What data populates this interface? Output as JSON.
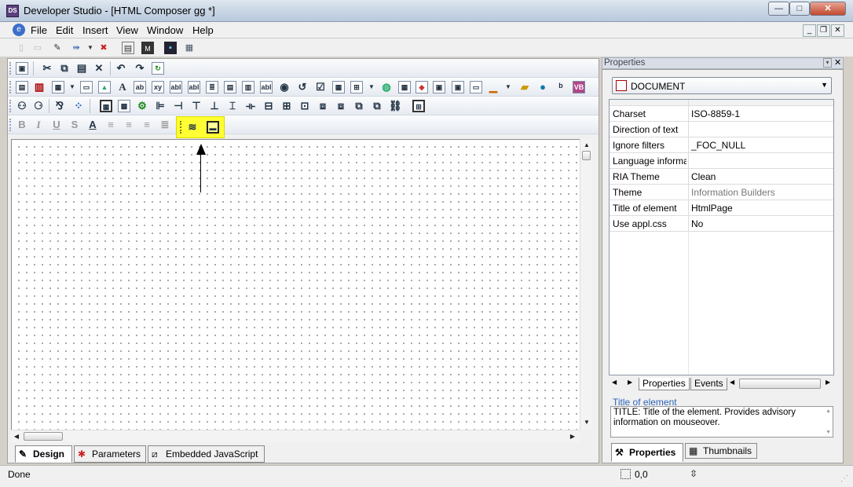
{
  "window": {
    "title": "Developer Studio - [HTML Composer gg *]",
    "app_icon_text": "DS",
    "controls": {
      "minimize": "—",
      "maximize": "□",
      "close": "✕"
    }
  },
  "menu": {
    "items": [
      "File",
      "Edit",
      "Insert",
      "View",
      "Window",
      "Help"
    ],
    "mdi_controls": {
      "minimize": "_",
      "restore": "❐",
      "close": "✕"
    }
  },
  "canvas": {
    "annotation_arrow_direction": "up",
    "highlight_color": "#ffff33"
  },
  "bottom_tabs": [
    {
      "label": "Design",
      "icon": "pencil-page-icon",
      "active": true
    },
    {
      "label": "Parameters",
      "icon": "parameters-icon",
      "active": false
    },
    {
      "label": "Embedded JavaScript",
      "icon": "script-icon",
      "active": false
    }
  ],
  "properties": {
    "title": "Properties",
    "selected_object": "DOCUMENT",
    "rows": [
      {
        "name": "Charset",
        "value": "ISO-8859-1",
        "muted": false
      },
      {
        "name": "Direction of text",
        "value": "",
        "muted": false
      },
      {
        "name": "Ignore filters",
        "value": "_FOC_NULL",
        "muted": false
      },
      {
        "name": "Language informatio",
        "value": "",
        "muted": false
      },
      {
        "name": "RIA Theme",
        "value": "Clean",
        "muted": false
      },
      {
        "name": "Theme",
        "value": "Information Builders",
        "muted": true
      },
      {
        "name": "Title of element",
        "value": "HtmlPage",
        "muted": false
      },
      {
        "name": "Use appl.css",
        "value": "No",
        "muted": false
      }
    ],
    "grid_tabs": [
      "Properties",
      "Events"
    ],
    "description_title": "Title of element",
    "description_text": "TITLE: Title of the element. Provides advisory information on mouseover.",
    "panel_tabs": [
      {
        "label": "Properties",
        "active": true
      },
      {
        "label": "Thumbnails",
        "active": false
      }
    ]
  },
  "status": {
    "text": "Done",
    "position": "0,0"
  }
}
